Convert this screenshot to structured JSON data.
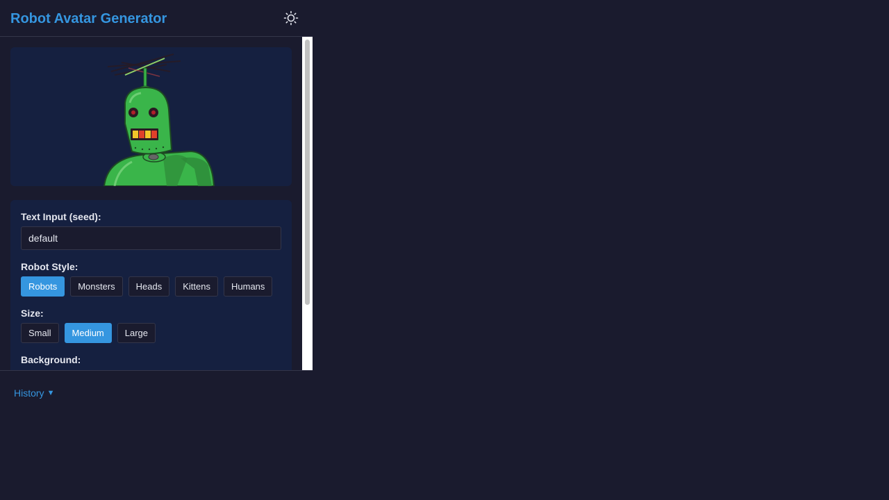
{
  "header": {
    "title": "Robot Avatar Generator",
    "theme_icon": "sun-icon"
  },
  "preview": {
    "avatar_description_icon": "robot-avatar-image"
  },
  "controls": {
    "seed_label": "Text Input (seed):",
    "seed_value": "default",
    "style_label": "Robot Style:",
    "styles": [
      {
        "label": "Robots",
        "active": true
      },
      {
        "label": "Monsters",
        "active": false
      },
      {
        "label": "Heads",
        "active": false
      },
      {
        "label": "Kittens",
        "active": false
      },
      {
        "label": "Humans",
        "active": false
      }
    ],
    "size_label": "Size:",
    "sizes": [
      {
        "label": "Small",
        "active": false
      },
      {
        "label": "Medium",
        "active": true
      },
      {
        "label": "Large",
        "active": false
      }
    ],
    "background_label": "Background:"
  },
  "history": {
    "label": "History",
    "caret": "▼"
  },
  "colors": {
    "accent": "#3596e0",
    "page_bg": "#1a1b2e",
    "card_bg": "#152040",
    "robot_green": "#3ab54a"
  }
}
